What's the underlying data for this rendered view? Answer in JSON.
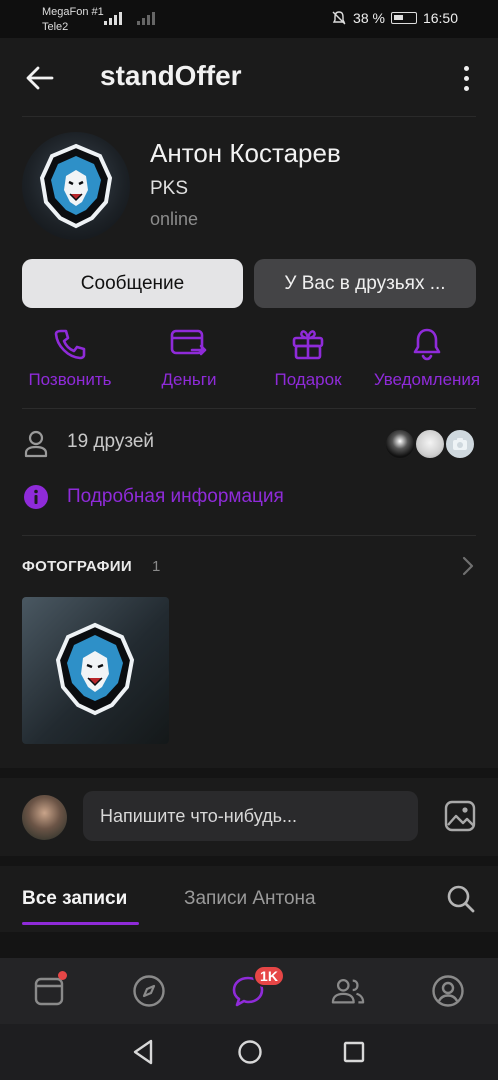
{
  "status_bar": {
    "carrier1": "MegaFon #1",
    "carrier2": "Tele2",
    "battery": "38 %",
    "time": "16:50"
  },
  "header": {
    "title": "standOffer"
  },
  "profile": {
    "name": "Антон Костарев",
    "subtitle": "PKS",
    "status": "online"
  },
  "buttons": {
    "message": "Сообщение",
    "friends": "У Вас в друзьях ..."
  },
  "actions": [
    {
      "label": "Позвонить",
      "icon": "phone-icon"
    },
    {
      "label": "Деньги",
      "icon": "card-transfer-icon"
    },
    {
      "label": "Подарок",
      "icon": "gift-icon"
    },
    {
      "label": "Уведомления",
      "icon": "bell-icon"
    }
  ],
  "friends": {
    "count_label": "19 друзей"
  },
  "info": {
    "label": "Подробная информация"
  },
  "photos": {
    "title": "ФОТОГРАФИИ",
    "count": "1"
  },
  "compose": {
    "placeholder": "Напишите что-нибудь..."
  },
  "tabs": [
    {
      "label": "Все записи",
      "active": true
    },
    {
      "label": "Записи Антона",
      "active": false
    }
  ],
  "bottom_nav": {
    "messages_badge": "1K"
  },
  "colors": {
    "accent": "#8f2bd9",
    "badge": "#e64646",
    "background": "#141414",
    "surface": "#1b1b1b"
  }
}
